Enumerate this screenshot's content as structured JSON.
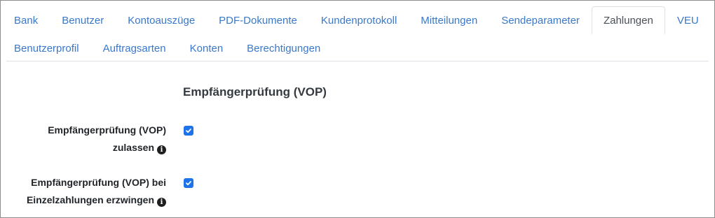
{
  "tabs": {
    "row1": [
      {
        "label": "Bank",
        "active": false
      },
      {
        "label": "Benutzer",
        "active": false
      },
      {
        "label": "Kontoauszüge",
        "active": false
      },
      {
        "label": "PDF-Dokumente",
        "active": false
      },
      {
        "label": "Kundenprotokoll",
        "active": false
      },
      {
        "label": "Mitteilungen",
        "active": false
      },
      {
        "label": "Sendeparameter",
        "active": false
      },
      {
        "label": "Zahlungen",
        "active": true
      },
      {
        "label": "VEU",
        "active": false
      }
    ],
    "row2": [
      {
        "label": "Benutzerprofil",
        "active": false
      },
      {
        "label": "Auftragsarten",
        "active": false
      },
      {
        "label": "Konten",
        "active": false
      },
      {
        "label": "Berechtigungen",
        "active": false
      }
    ]
  },
  "section": {
    "title": "Empfängerprüfung (VOP)"
  },
  "settings": [
    {
      "label_line1": "Empfängerprüfung (VOP)",
      "label_line2": "zulassen",
      "checked": true,
      "info_icon": "info-circle-icon"
    },
    {
      "label_line1": "Empfängerprüfung (VOP) bei",
      "label_line2": "Einzelzahlungen erzwingen",
      "checked": true,
      "info_icon": "info-circle-icon"
    }
  ],
  "colors": {
    "link": "#3a78c9",
    "checkbox": "#1e73e8",
    "tab_border": "#dee2e6"
  }
}
